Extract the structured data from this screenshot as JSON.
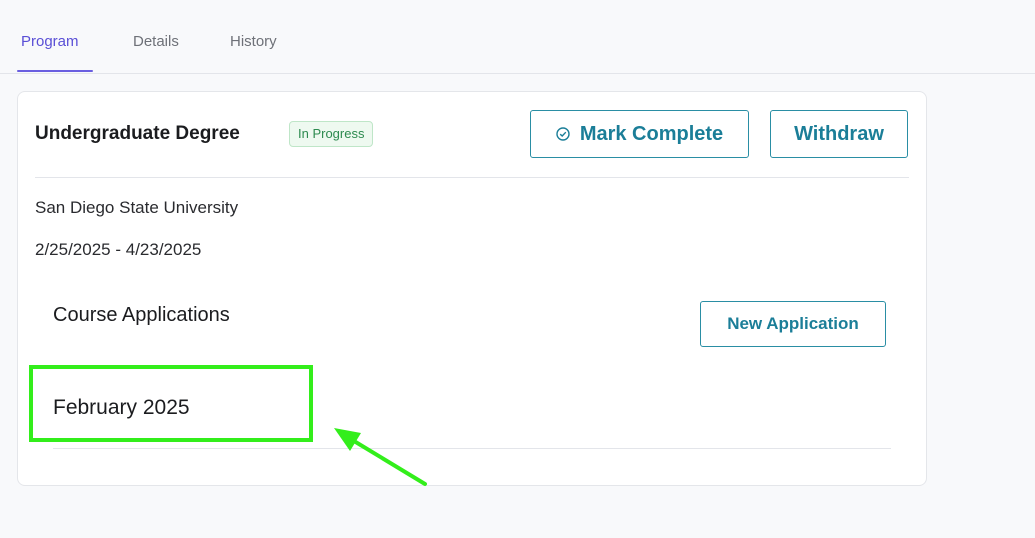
{
  "tabs": [
    {
      "label": "Program",
      "active": true
    },
    {
      "label": "Details",
      "active": false
    },
    {
      "label": "History",
      "active": false
    }
  ],
  "program": {
    "title": "Undergraduate Degree",
    "status": "In Progress",
    "mark_complete_label": "Mark Complete",
    "withdraw_label": "Withdraw",
    "institution": "San Diego State University",
    "date_range": "2/25/2025 - 4/23/2025"
  },
  "course_applications": {
    "title": "Course Applications",
    "new_application_label": "New Application",
    "month": "February 2025"
  },
  "colors": {
    "accent": "#1b7e98",
    "tab_active": "#5a4fd6",
    "status_green": "#2d8a4f",
    "highlight": "#33ee1b"
  },
  "icons": {
    "mark_complete": "check-circle-icon",
    "annotation": "arrow-icon"
  }
}
